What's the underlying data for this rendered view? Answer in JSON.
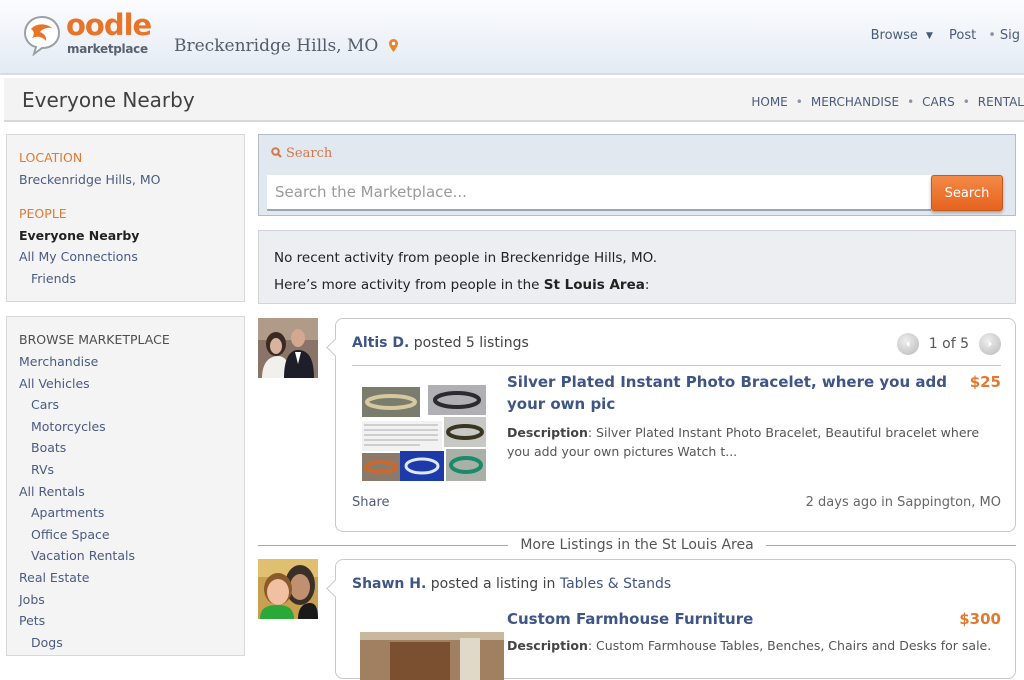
{
  "header": {
    "logo_word": "oodle",
    "logo_sub": "marketplace",
    "location": "Breckenridge Hills, MO",
    "nav": [
      "Browse",
      "Post",
      "Sig"
    ]
  },
  "subbar": {
    "title": "Everyone Nearby",
    "nav": [
      "HOME",
      "MERCHANDISE",
      "CARS",
      "RENTAL"
    ]
  },
  "sidebar": {
    "location_head": "LOCATION",
    "location_value": "Breckenridge Hills, MO",
    "people_head": "PEOPLE",
    "people": [
      {
        "label": "Everyone Nearby",
        "active": true
      },
      {
        "label": "All My Connections"
      },
      {
        "label": "Friends",
        "sub": true
      }
    ],
    "browse_head": "BROWSE MARKETPLACE",
    "browse": [
      {
        "label": "Merchandise"
      },
      {
        "label": "All Vehicles"
      },
      {
        "label": "Cars",
        "sub": true
      },
      {
        "label": "Motorcycles",
        "sub": true
      },
      {
        "label": "Boats",
        "sub": true
      },
      {
        "label": "RVs",
        "sub": true
      },
      {
        "label": "All Rentals"
      },
      {
        "label": "Apartments",
        "sub": true
      },
      {
        "label": "Office Space",
        "sub": true
      },
      {
        "label": "Vacation Rentals",
        "sub": true
      },
      {
        "label": "Real Estate"
      },
      {
        "label": "Jobs"
      },
      {
        "label": "Pets"
      },
      {
        "label": "Dogs",
        "sub": true
      }
    ]
  },
  "search": {
    "label": "Search",
    "placeholder": "Search the Marketplace...",
    "button": "Search"
  },
  "notice": {
    "line1": "No recent activity from people in Breckenridge Hills, MO.",
    "line2_prefix": "Here’s more activity from people in the ",
    "line2_area": "St Louis Area",
    "line2_suffix": ":"
  },
  "feed": [
    {
      "user": "Altis D.",
      "action": " posted 5 listings",
      "pager": "1 of 5",
      "title": "Silver Plated Instant Photo Bracelet, where you add your own pic",
      "price": "$25",
      "desc_label": "Description",
      "desc": ": Silver Plated Instant Photo Bracelet, Beautiful bracelet where you add your own pictures Watch t...",
      "share": "Share",
      "meta": "2 days ago in Sappington, MO"
    },
    {
      "user": "Shawn H.",
      "action": " posted a listing in ",
      "category": "Tables & Stands",
      "title": "Custom Farmhouse Furniture",
      "price": "$300",
      "desc_label": "Description",
      "desc": ": Custom Farmhouse Tables, Benches, Chairs and Desks for sale."
    }
  ],
  "divider": "More Listings in the St Louis Area",
  "colors": {
    "accent_orange": "#e07a30",
    "link_blue": "#3e5585"
  }
}
